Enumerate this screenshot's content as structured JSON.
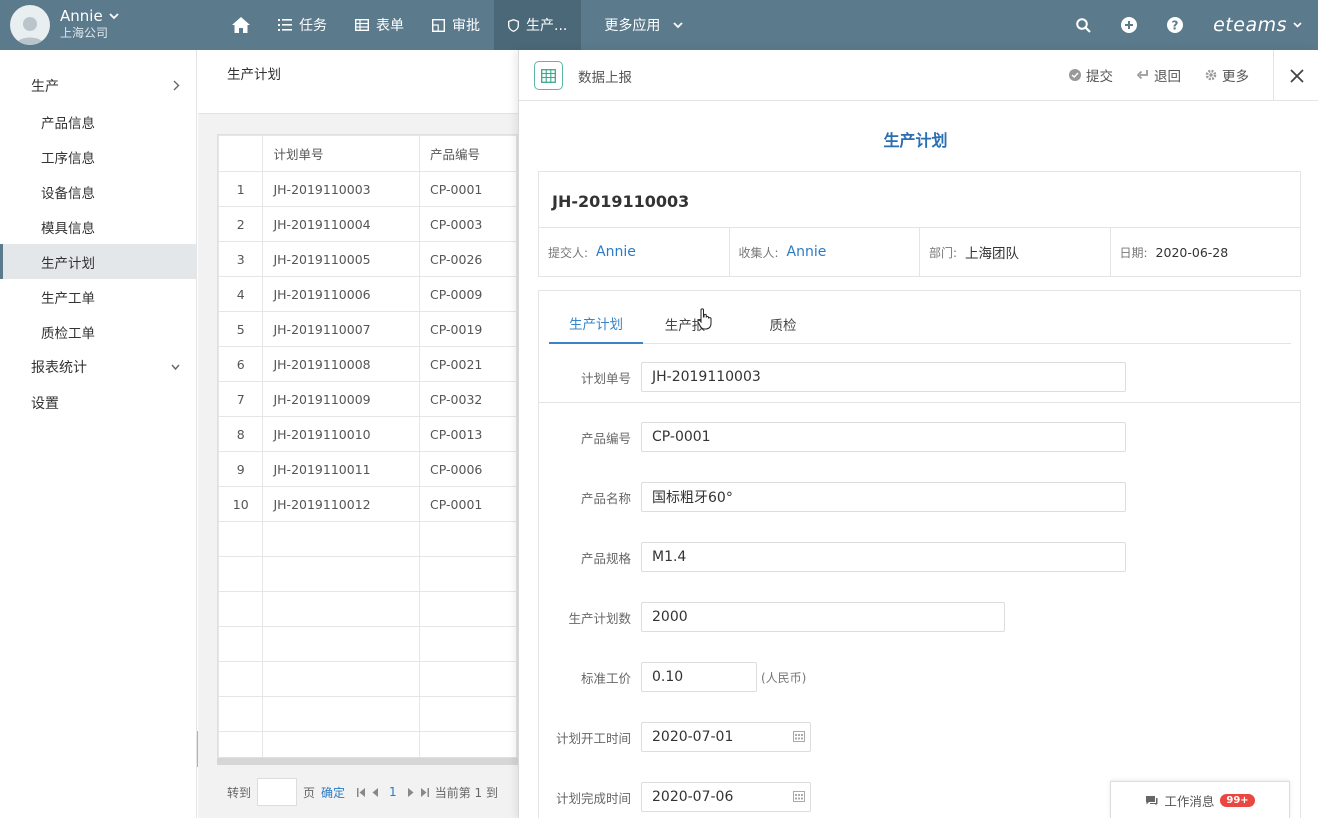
{
  "user": {
    "name": "Annie",
    "company": "上海公司"
  },
  "nav": {
    "items": [
      {
        "label": "",
        "icon": "home-icon"
      },
      {
        "label": "任务",
        "icon": "list-icon"
      },
      {
        "label": "表单",
        "icon": "table-icon"
      },
      {
        "label": "审批",
        "icon": "approval-icon"
      },
      {
        "label": "生产...",
        "icon": "shield-icon",
        "active": true
      },
      {
        "label": "更多应用",
        "icon": "chevron-down-icon"
      }
    ],
    "brand": "eteams"
  },
  "sidebar": {
    "groups": [
      {
        "label": "生产",
        "icon": "chevron-right-icon"
      },
      {
        "label": "报表统计",
        "icon": "chevron-down-icon"
      },
      {
        "label": "设置"
      }
    ],
    "items": [
      "产品信息",
      "工序信息",
      "设备信息",
      "模具信息",
      "生产计划",
      "生产工单",
      "质检工单"
    ],
    "active_item": "生产计划"
  },
  "list": {
    "title": "生产计划",
    "columns": [
      "",
      "计划单号",
      "产品编号"
    ],
    "rows": [
      {
        "no": "1",
        "plan": "JH-2019110003",
        "product": "CP-0001"
      },
      {
        "no": "2",
        "plan": "JH-2019110004",
        "product": "CP-0003"
      },
      {
        "no": "3",
        "plan": "JH-2019110005",
        "product": "CP-0026"
      },
      {
        "no": "4",
        "plan": "JH-2019110006",
        "product": "CP-0009"
      },
      {
        "no": "5",
        "plan": "JH-2019110007",
        "product": "CP-0019"
      },
      {
        "no": "6",
        "plan": "JH-2019110008",
        "product": "CP-0021"
      },
      {
        "no": "7",
        "plan": "JH-2019110009",
        "product": "CP-0032"
      },
      {
        "no": "8",
        "plan": "JH-2019110010",
        "product": "CP-0013"
      },
      {
        "no": "9",
        "plan": "JH-2019110011",
        "product": "CP-0006"
      },
      {
        "no": "10",
        "plan": "JH-2019110012",
        "product": "CP-0001"
      }
    ],
    "pager": {
      "goto": "转到",
      "page": "页",
      "confirm": "确定",
      "current_page": "1",
      "status": "当前第 1 到"
    }
  },
  "panel": {
    "title": "数据上报",
    "actions": {
      "submit": "提交",
      "back": "退回",
      "more": "更多"
    },
    "form_title": "生产计划",
    "record_id": "JH-2019110003",
    "summary": {
      "submitter_label": "提交人:",
      "submitter": "Annie",
      "collector_label": "收集人:",
      "collector": "Annie",
      "dept_label": "部门:",
      "dept": "上海团队",
      "date_label": "日期:",
      "date": "2020-06-28"
    },
    "tabs": [
      "生产计划",
      "生产报",
      "质检"
    ],
    "fields": {
      "plan_no": {
        "label": "计划单号",
        "value": "JH-2019110003"
      },
      "product_no": {
        "label": "产品编号",
        "value": "CP-0001"
      },
      "product_name": {
        "label": "产品名称",
        "value": "国标粗牙60°"
      },
      "product_spec": {
        "label": "产品规格",
        "value": "M1.4"
      },
      "plan_qty": {
        "label": "生产计划数",
        "value": "2000"
      },
      "std_price": {
        "label": "标准工价",
        "value": "0.10",
        "suffix": "(人民币)"
      },
      "start_date": {
        "label": "计划开工时间",
        "value": "2020-07-01"
      },
      "end_date": {
        "label": "计划完成时间",
        "value": "2020-07-06"
      }
    }
  },
  "messages": {
    "label": "工作消息",
    "badge": "99+"
  },
  "colors": {
    "topbar": "#5b7a8c",
    "accent": "#2a7bc4",
    "badge": "#e9473f"
  }
}
